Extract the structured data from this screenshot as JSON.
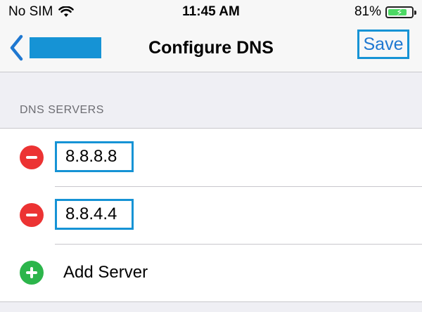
{
  "status_bar": {
    "carrier": "No SIM",
    "time": "11:45 AM",
    "battery_percent": "81%",
    "battery_level": 0.81,
    "wifi_icon": "wifi-icon",
    "battery_icon": "battery-charging-icon"
  },
  "nav": {
    "back_label": "",
    "title": "Configure DNS",
    "save_label": "Save"
  },
  "dns": {
    "section_header": "DNS SERVERS",
    "servers": [
      "8.8.8.8",
      "8.8.4.4"
    ],
    "add_label": "Add Server"
  },
  "colors": {
    "accent": "#1f78d1",
    "highlight_box": "#1693d5",
    "delete": "#ec3333",
    "add": "#2cb54b",
    "battery": "#4cd964"
  }
}
